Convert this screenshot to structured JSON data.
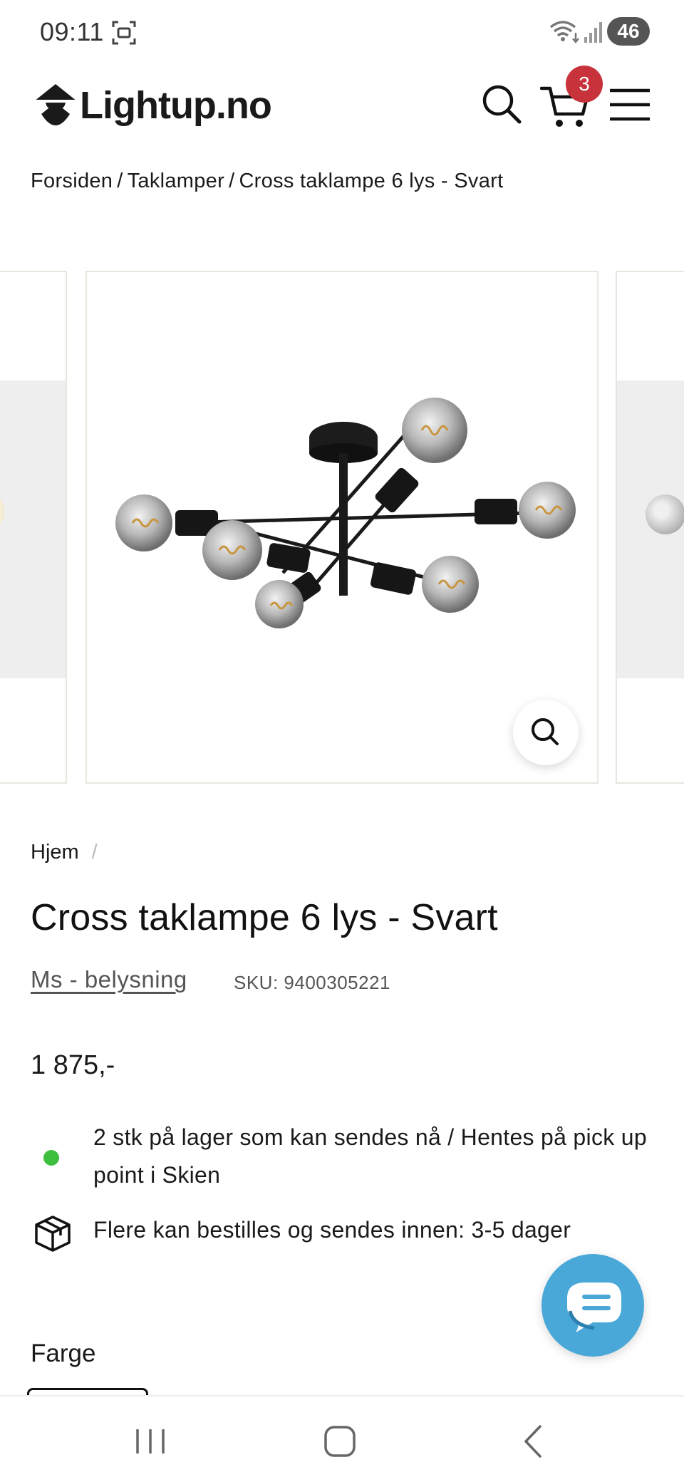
{
  "status_bar": {
    "time": "09:11",
    "battery": "46"
  },
  "header": {
    "logo_text": "Lightup.no",
    "cart_count": "3"
  },
  "breadcrumb": {
    "items": [
      "Forsiden",
      "Taklamper",
      "Cross taklampe 6 lys - Svart"
    ],
    "separator": "/"
  },
  "product": {
    "crumb": "Hjem",
    "crumb_sep": "/",
    "title": "Cross taklampe 6 lys - Svart",
    "brand": "Ms - belysning",
    "sku": "SKU: 9400305221",
    "price": "1 875,-",
    "stock_text": "2 stk på lager som kan sendes nå / Hentes på pick up point i Skien",
    "order_text": "Flere kan bestilles og sendes innen: 3-5 dager",
    "color_label": "Farge"
  },
  "icons": {
    "search": "search-icon",
    "cart": "cart-icon",
    "menu": "hamburger-menu-icon",
    "zoom": "zoom-icon",
    "box": "box-icon",
    "chat": "chat-icon"
  },
  "colors": {
    "accent_badge": "#c8323a",
    "stock_green": "#3fbf3f",
    "chat_blue": "#4aa8d8"
  }
}
